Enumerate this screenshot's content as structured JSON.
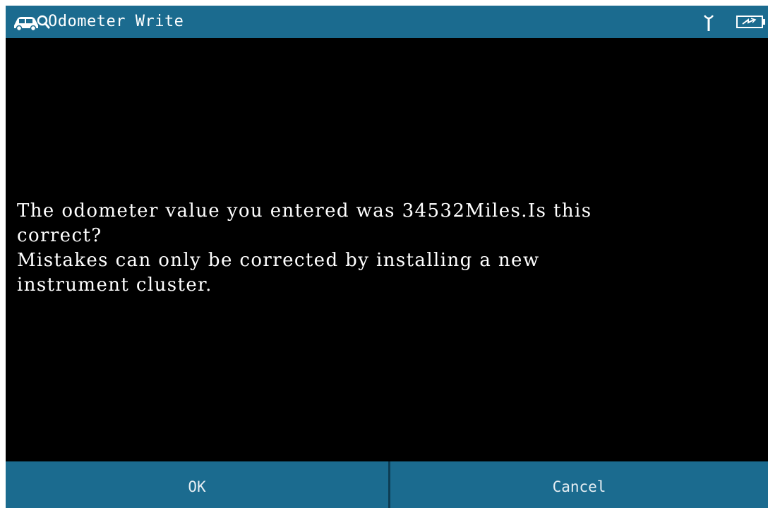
{
  "window": {
    "title": "Odometer Write",
    "car_icon": "car-with-magnifier-icon",
    "signal_icon": "signal-antenna-icon",
    "battery_icon": "battery-charging-icon"
  },
  "message": {
    "lines": [
      "The odometer value you entered was 34532Miles.Is this",
      "correct?",
      "Mistakes can only be corrected by installing a new",
      "instrument cluster."
    ]
  },
  "buttons": {
    "ok_label": "OK",
    "cancel_label": "Cancel"
  },
  "colors": {
    "bar": "#1b6b8f",
    "background": "#000000",
    "text": "#ffffff"
  }
}
